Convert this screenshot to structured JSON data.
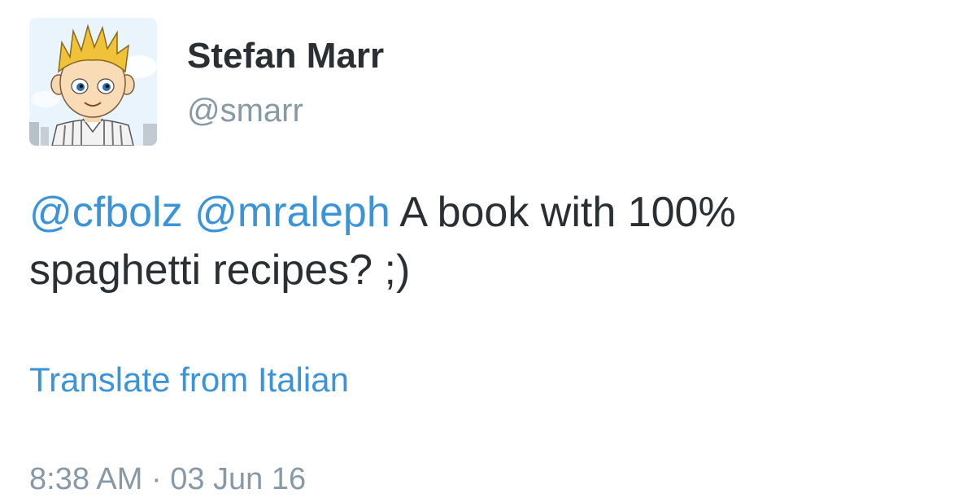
{
  "tweet": {
    "author": {
      "name": "Stefan Marr",
      "handle": "@smarr"
    },
    "text": {
      "mentions": [
        "@cfbolz",
        "@mraleph"
      ],
      "line1_rest": "A book with 100%",
      "line2": "spaghetti recipes? ;)"
    },
    "translate_label": "Translate from Italian",
    "timestamp": "8:38 AM · 03 Jun 16"
  },
  "colors": {
    "link": "#3b94d9",
    "text": "#292f33",
    "muted": "#8899a6"
  },
  "icons": {
    "avatar": "cartoon-avatar"
  }
}
